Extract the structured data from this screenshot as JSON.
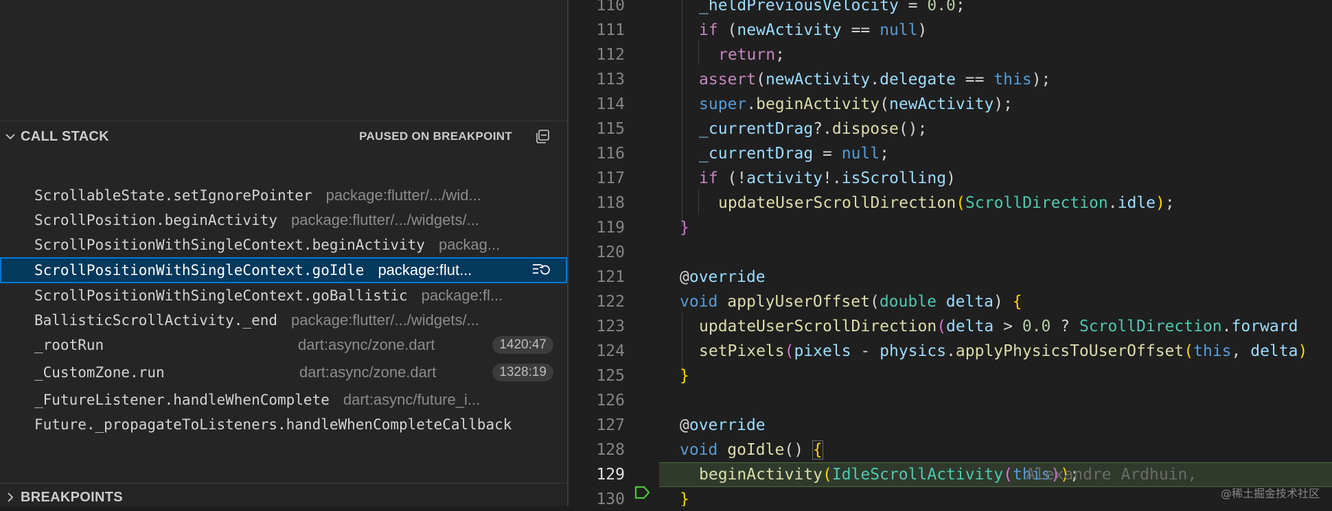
{
  "call_stack": {
    "title": "CALL STACK",
    "status": "PAUSED ON BREAKPOINT",
    "frames": [
      {
        "name": "ScrollableState.setIgnorePointer",
        "source": "package:flutter/.../wid...",
        "badge": ""
      },
      {
        "name": "ScrollPosition.beginActivity",
        "source": "package:flutter/.../widgets/...",
        "badge": ""
      },
      {
        "name": "ScrollPositionWithSingleContext.beginActivity",
        "source": "packag...",
        "badge": ""
      },
      {
        "name": "ScrollPositionWithSingleContext.goIdle",
        "source": "package:flut...",
        "badge": "",
        "selected": true
      },
      {
        "name": "ScrollPositionWithSingleContext.goBallistic",
        "source": "package:fl...",
        "badge": ""
      },
      {
        "name": "BallisticScrollActivity._end",
        "source": "package:flutter/.../widgets/...",
        "badge": ""
      },
      {
        "name": "_rootRun",
        "source": "dart:async/zone.dart",
        "badge": "1420:47"
      },
      {
        "name": "_CustomZone.run",
        "source": "dart:async/zone.dart",
        "badge": "1328:19"
      },
      {
        "name": "_FutureListener.handleWhenComplete",
        "source": "dart:async/future_i...",
        "badge": ""
      },
      {
        "name": "Future._propagateToListeners.handleWhenCompleteCallback",
        "source": "",
        "badge": ""
      }
    ]
  },
  "breakpoints": {
    "title": "BREAKPOINTS"
  },
  "editor": {
    "line_numbers": [
      "110",
      "111",
      "112",
      "113",
      "114",
      "115",
      "116",
      "117",
      "118",
      "119",
      "120",
      "121",
      "122",
      "123",
      "124",
      "125",
      "126",
      "127",
      "128",
      "129",
      "130"
    ],
    "current_line": "129",
    "blame": "Alexandre Ardhuin,"
  },
  "watermark": "@稀土掘金技术社区",
  "icons": {
    "call_stack_chevron": "chevron-down-icon",
    "collapse_all": "collapse-all-icon",
    "restart_frame": "restart-frame-icon",
    "breakpoints_chevron": "chevron-right-icon",
    "debug_pointer": "debug-stackframe-icon"
  },
  "colors": {
    "selection_bg": "#04395e",
    "selection_border": "#0078d4",
    "current_line_bg": "#2f3a2c",
    "breakpoint_pointer": "#4ec43b"
  }
}
